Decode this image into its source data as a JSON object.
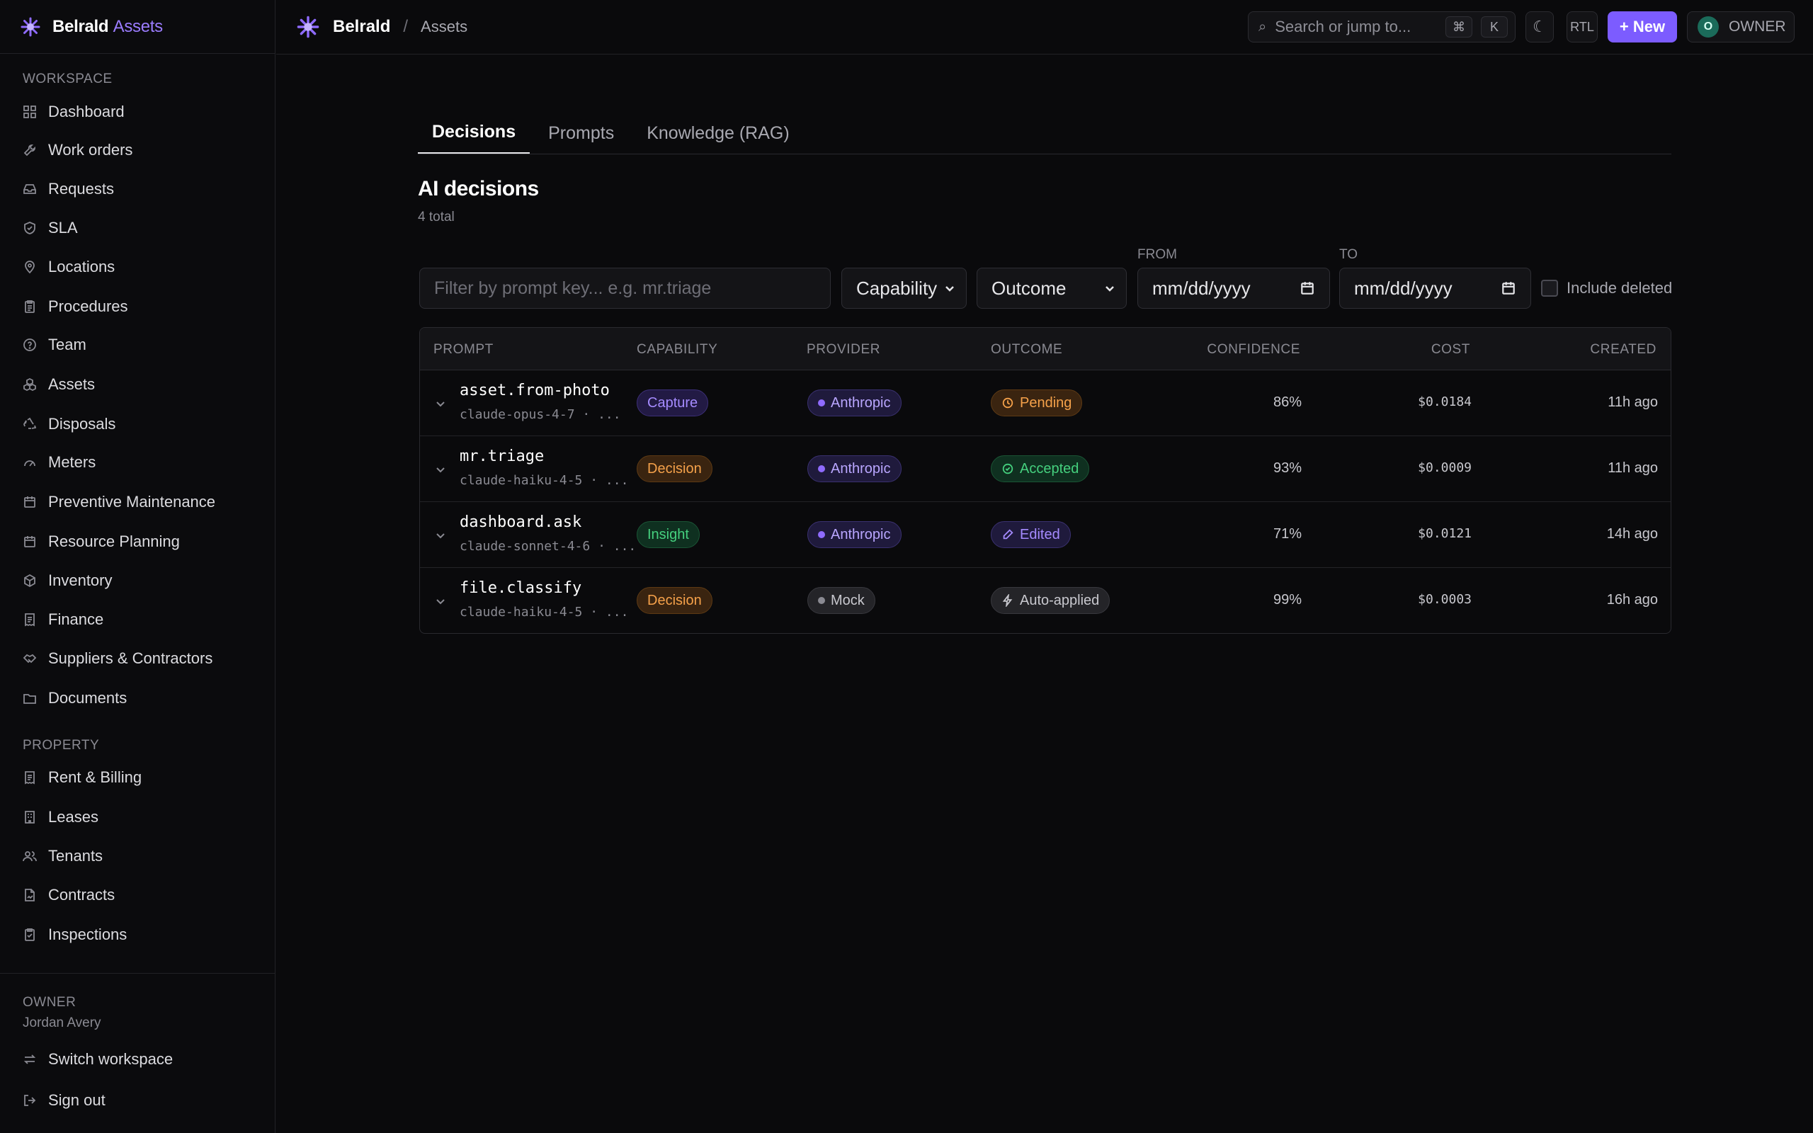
{
  "brand": {
    "name": "Belrald",
    "accent": "Assets"
  },
  "sidebar": {
    "workspace_label": "WORKSPACE",
    "workspace_items": [
      {
        "label": "Dashboard",
        "icon": "grid-icon"
      },
      {
        "label": "Work orders",
        "icon": "wrench-icon"
      },
      {
        "label": "Requests",
        "icon": "inbox-icon"
      },
      {
        "label": "SLA",
        "icon": "shield-icon"
      },
      {
        "label": "Locations",
        "icon": "map-pin-icon"
      },
      {
        "label": "Procedures",
        "icon": "clipboard-icon"
      },
      {
        "label": "Team",
        "icon": "help-circle-icon"
      },
      {
        "label": "Assets",
        "icon": "boxes-icon"
      },
      {
        "label": "Disposals",
        "icon": "recycle-icon"
      },
      {
        "label": "Meters",
        "icon": "gauge-icon"
      },
      {
        "label": "Preventive Maintenance",
        "icon": "calendar-icon"
      },
      {
        "label": "Resource Planning",
        "icon": "calendar-icon"
      },
      {
        "label": "Inventory",
        "icon": "package-icon"
      },
      {
        "label": "Finance",
        "icon": "receipt-icon"
      },
      {
        "label": "Suppliers & Contractors",
        "icon": "handshake-icon"
      },
      {
        "label": "Documents",
        "icon": "folder-icon"
      }
    ],
    "property_label": "PROPERTY",
    "property_items": [
      {
        "label": "Rent & Billing",
        "icon": "receipt-icon"
      },
      {
        "label": "Leases",
        "icon": "building-icon"
      },
      {
        "label": "Tenants",
        "icon": "users-icon"
      },
      {
        "label": "Contracts",
        "icon": "file-signature-icon"
      },
      {
        "label": "Inspections",
        "icon": "clipboard-check-icon"
      }
    ],
    "footer": {
      "role": "OWNER",
      "user": "Jordan Avery",
      "switch_label": "Switch workspace",
      "signout_label": "Sign out"
    }
  },
  "topbar": {
    "org": "Belrald",
    "separator": "/",
    "page": "Assets",
    "search_placeholder": "Search or jump to...",
    "kbd_cmd": "⌘",
    "kbd_k": "K",
    "rtl_label": "RTL",
    "new_label": "+ New",
    "owner_initial": "O",
    "owner_label": "OWNER"
  },
  "tabs": [
    {
      "label": "Decisions",
      "active": true
    },
    {
      "label": "Prompts",
      "active": false
    },
    {
      "label": "Knowledge (RAG)",
      "active": false
    }
  ],
  "page": {
    "title": "AI decisions",
    "subtitle": "4 total"
  },
  "filters": {
    "prompt_placeholder": "Filter by prompt key... e.g. mr.triage",
    "capability_label": "Capability",
    "outcome_label": "Outcome",
    "from_label": "FROM",
    "to_label": "TO",
    "date_placeholder": "mm/dd/yyyy",
    "include_deleted_label": "Include deleted"
  },
  "table": {
    "headers": {
      "prompt": "PROMPT",
      "capability": "CAPABILITY",
      "provider": "PROVIDER",
      "outcome": "OUTCOME",
      "confidence": "CONFIDENCE",
      "cost": "COST",
      "created": "CREATED"
    },
    "rows": [
      {
        "prompt": "asset.from-photo",
        "model": "claude-opus-4-7 · ...",
        "capability": "Capture",
        "provider": "Anthropic",
        "outcome": "Pending",
        "confidence": "86%",
        "cost": "$0.0184",
        "created": "11h ago"
      },
      {
        "prompt": "mr.triage",
        "model": "claude-haiku-4-5 · ...",
        "capability": "Decision",
        "provider": "Anthropic",
        "outcome": "Accepted",
        "confidence": "93%",
        "cost": "$0.0009",
        "created": "11h ago"
      },
      {
        "prompt": "dashboard.ask",
        "model": "claude-sonnet-4-6 · ...",
        "capability": "Insight",
        "provider": "Anthropic",
        "outcome": "Edited",
        "confidence": "71%",
        "cost": "$0.0121",
        "created": "14h ago"
      },
      {
        "prompt": "file.classify",
        "model": "claude-haiku-4-5 · ...",
        "capability": "Decision",
        "provider": "Mock",
        "outcome": "Auto-applied",
        "confidence": "99%",
        "cost": "$0.0003",
        "created": "16h ago"
      }
    ]
  },
  "colors": {
    "accent": "#7c5cff",
    "background": "#0a0a0c"
  }
}
